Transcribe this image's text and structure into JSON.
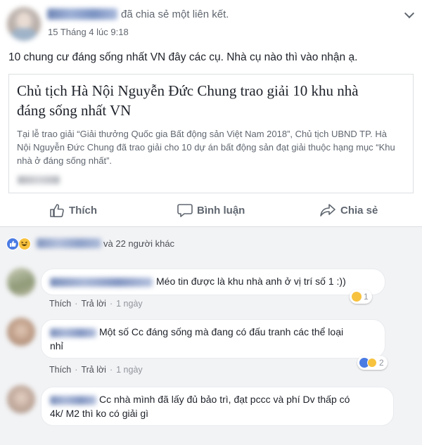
{
  "post": {
    "action_text": "đã chia sẻ một liên kết.",
    "time": "15 Tháng 4 lúc 9:18",
    "text": "10 chung cư đáng sống nhất VN đây các cụ. Nhà cụ nào thì vào nhận ạ."
  },
  "link": {
    "title": "Chủ tịch Hà Nội Nguyễn Đức Chung trao giải 10 khu nhà đáng sống nhất VN",
    "description": "Tại lễ trao giải “Giải thưởng Quốc gia Bất động sản Việt Nam 2018”, Chủ tịch UBND TP. Hà Nội Nguyễn Đức Chung đã trao giải cho 10 dự án bất động sản đạt giải thuộc hạng mục “Khu nhà ở đáng sống nhất”."
  },
  "actions": {
    "like": "Thích",
    "comment": "Bình luận",
    "share": "Chia sẻ"
  },
  "reactions": {
    "others": "và 22 người khác",
    "icons": [
      "like-icon",
      "haha-icon"
    ],
    "colors": {
      "like": "#4a7be3",
      "haha": "#f7c23e"
    }
  },
  "comments": [
    {
      "text_lines": [
        "Méo tin được là khu nhà anh ở vị trí số 1 :))"
      ],
      "like": "Thích",
      "reply": "Trả lời",
      "time": "1 ngày",
      "reaction_count": "1",
      "reaction_icons": [
        "haha-icon"
      ]
    },
    {
      "text_lines": [
        "Một số Cc đáng sống mà đang có đấu tranh các thể loại",
        "nhỉ"
      ],
      "like": "Thích",
      "reply": "Trả lời",
      "time": "1 ngày",
      "reaction_count": "2",
      "reaction_icons": [
        "like-icon",
        "haha-icon"
      ]
    },
    {
      "text_lines": [
        "Cc nhà mình đã lấy đủ bảo trì, đạt pccc và phí Dv thấp có",
        "4k/ M2 thì ko có giải gì"
      ],
      "like": "",
      "reply": "",
      "time": "",
      "reaction_count": "",
      "reaction_icons": []
    }
  ]
}
